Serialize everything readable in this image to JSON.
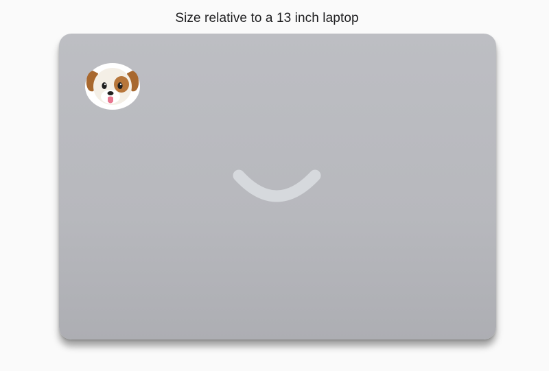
{
  "caption": "Size relative to a 13 inch laptop",
  "laptop": {
    "color": "#b9babf",
    "logo_color": "#d6d9dd"
  },
  "sticker": {
    "icon": "dog-face-icon",
    "emoji": "🐶"
  }
}
